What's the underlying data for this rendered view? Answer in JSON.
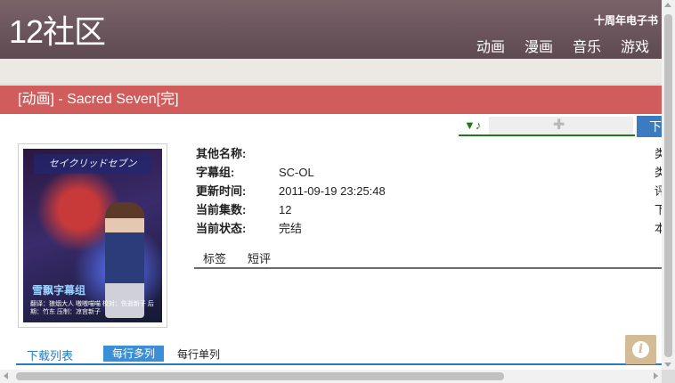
{
  "header": {
    "logo": "12社区",
    "anniversary": "十周年电子书",
    "nav": [
      "动画",
      "漫画",
      "音乐",
      "游戏"
    ]
  },
  "title": "[动画] - Sacred Seven[完]",
  "toolbar": {
    "music_icon": "▼♪",
    "plugin_icon": "puzzle-icon",
    "download_label": "下"
  },
  "poster": {
    "title": "セイクリッドセブン",
    "group": "雪飘字幕组",
    "credits": "翻译：狼烟大人 嗷嗷喵喵 校对：伤逝新子 后期：竹东 压制：凉宫新子"
  },
  "info": {
    "rows": [
      {
        "label": "其他名称:",
        "value": "",
        "edge": "类"
      },
      {
        "label": "字幕组:",
        "value": "SC-OL",
        "edge": "类"
      },
      {
        "label": "更新时间:",
        "value": "2011-09-19 23:25:48",
        "edge": "评"
      },
      {
        "label": "当前集数:",
        "value": "12",
        "edge": "下"
      },
      {
        "label": "当前状态:",
        "value": "完结",
        "edge": "本"
      }
    ]
  },
  "tabs": [
    "标签",
    "短评"
  ],
  "download": {
    "title": "下载列表",
    "multi": "每行多列",
    "single": "每行单列"
  },
  "info_button_glyph": "i",
  "colors": {
    "header": "#6b555c",
    "title_bar": "#d05c5c",
    "accent_blue": "#3b8fd6",
    "player_green": "#1b7a1b",
    "info_button": "#d3bb95"
  }
}
